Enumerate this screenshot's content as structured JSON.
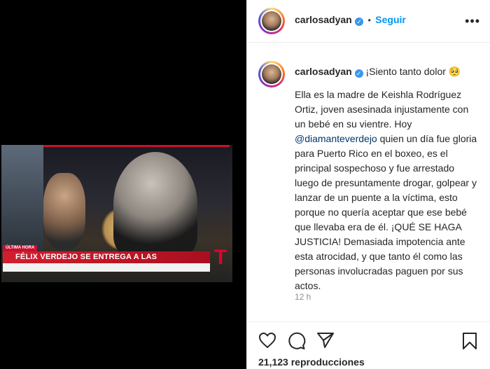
{
  "post": {
    "username": "carlosadyan",
    "follow_label": "Seguir",
    "separator": "•",
    "verified_mark": "✓",
    "caption_head": "¡Siento tanto dolor",
    "caption_emoji": "🥺",
    "caption_part1": "Ella es la madre de Keishla Rodríguez Ortiz, joven asesinada injustamente con un bebé en su vientre. Hoy ",
    "mention": "@diamanteverdejo",
    "caption_part2": " quien un día fue gloria para Puerto Rico en el boxeo, es el principal sospechoso y fue arrestado luego de presuntamente drogar, golpear y lanzar de un puente a la víctima, esto porque no quería aceptar que ese bebé que llevaba era de él. ¡QUÉ SE HAGA JUSTICIA! Demasiada impotencia ante esta atrocidad, y que tanto él como las personas involucradas paguen por sus actos.",
    "time": "12 h",
    "views": "21,123 reproducciones",
    "more_icon": "ellipsis-icon"
  },
  "video": {
    "label": "ÚLTIMA HORA",
    "headline": "FÉLIX VERDEJO SE ENTREGA A LAS AUTORIDADES",
    "logo": "T",
    "accent": "#c8102e"
  },
  "icons": {
    "like": "heart-icon",
    "comment": "comment-icon",
    "share": "share-icon",
    "save": "bookmark-icon"
  }
}
